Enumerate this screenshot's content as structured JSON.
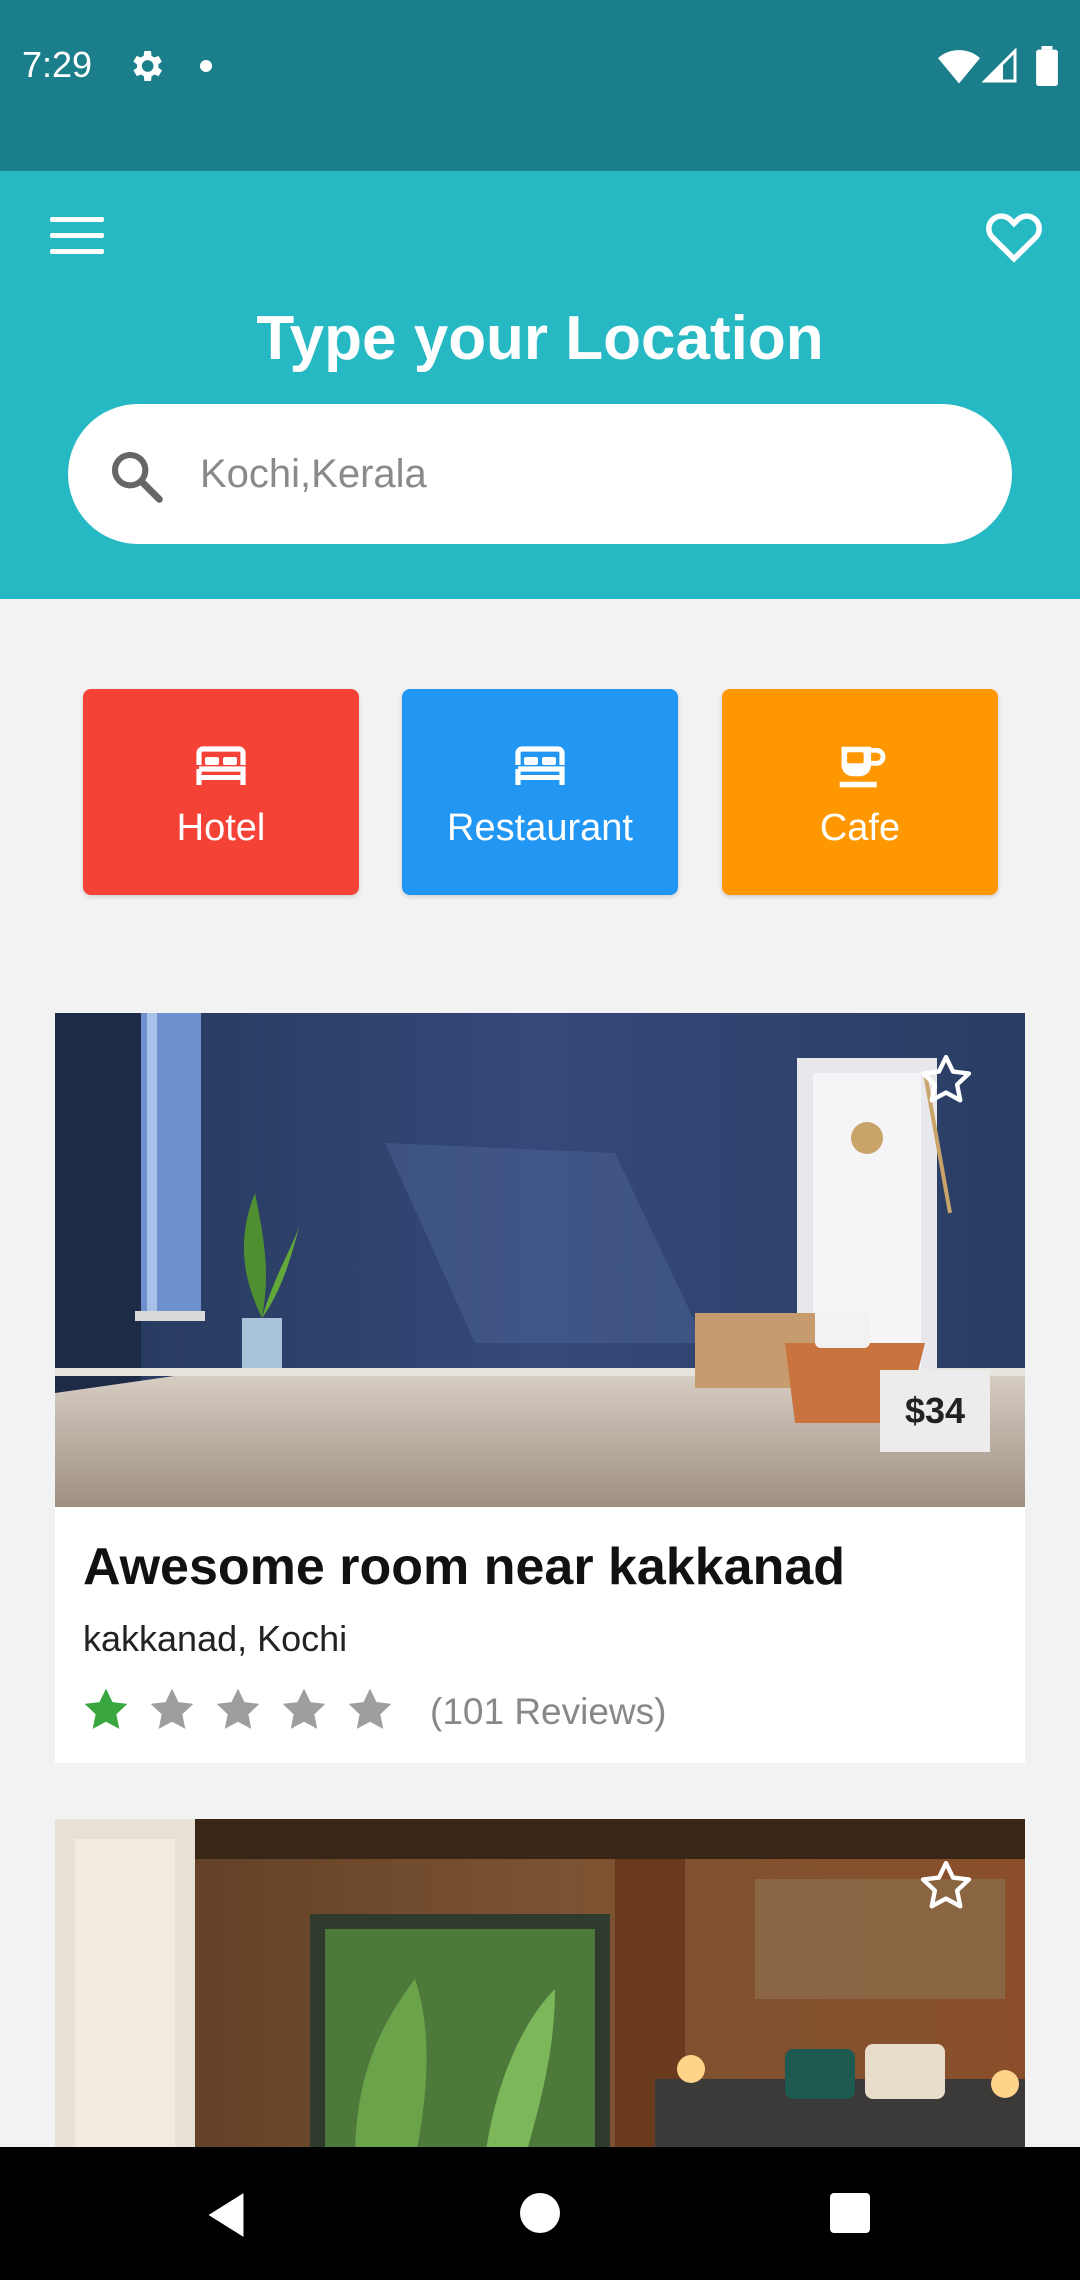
{
  "status": {
    "time": "7:29"
  },
  "header": {
    "title": "Type your Location",
    "search_placeholder": "Kochi,Kerala",
    "search_value": ""
  },
  "categories": [
    {
      "label": "Hotel",
      "icon": "bed-icon",
      "color": "#f44336"
    },
    {
      "label": "Restaurant",
      "icon": "bed-icon",
      "color": "#2196f3"
    },
    {
      "label": "Cafe",
      "icon": "coffee-cup-icon",
      "color": "#ff9800"
    }
  ],
  "listings": [
    {
      "title": "Awesome room near kakkanad",
      "location": "kakkanad, Kochi",
      "price": "$34",
      "rating": 1,
      "rating_max": 5,
      "reviews": "(101 Reviews)",
      "favorited": false
    },
    {
      "favorited": false
    }
  ],
  "colors": {
    "status_bar": "#1b7e8b",
    "header": "#26b9c3",
    "star_filled": "#3aa63f",
    "star_empty": "#9e9e9e"
  }
}
